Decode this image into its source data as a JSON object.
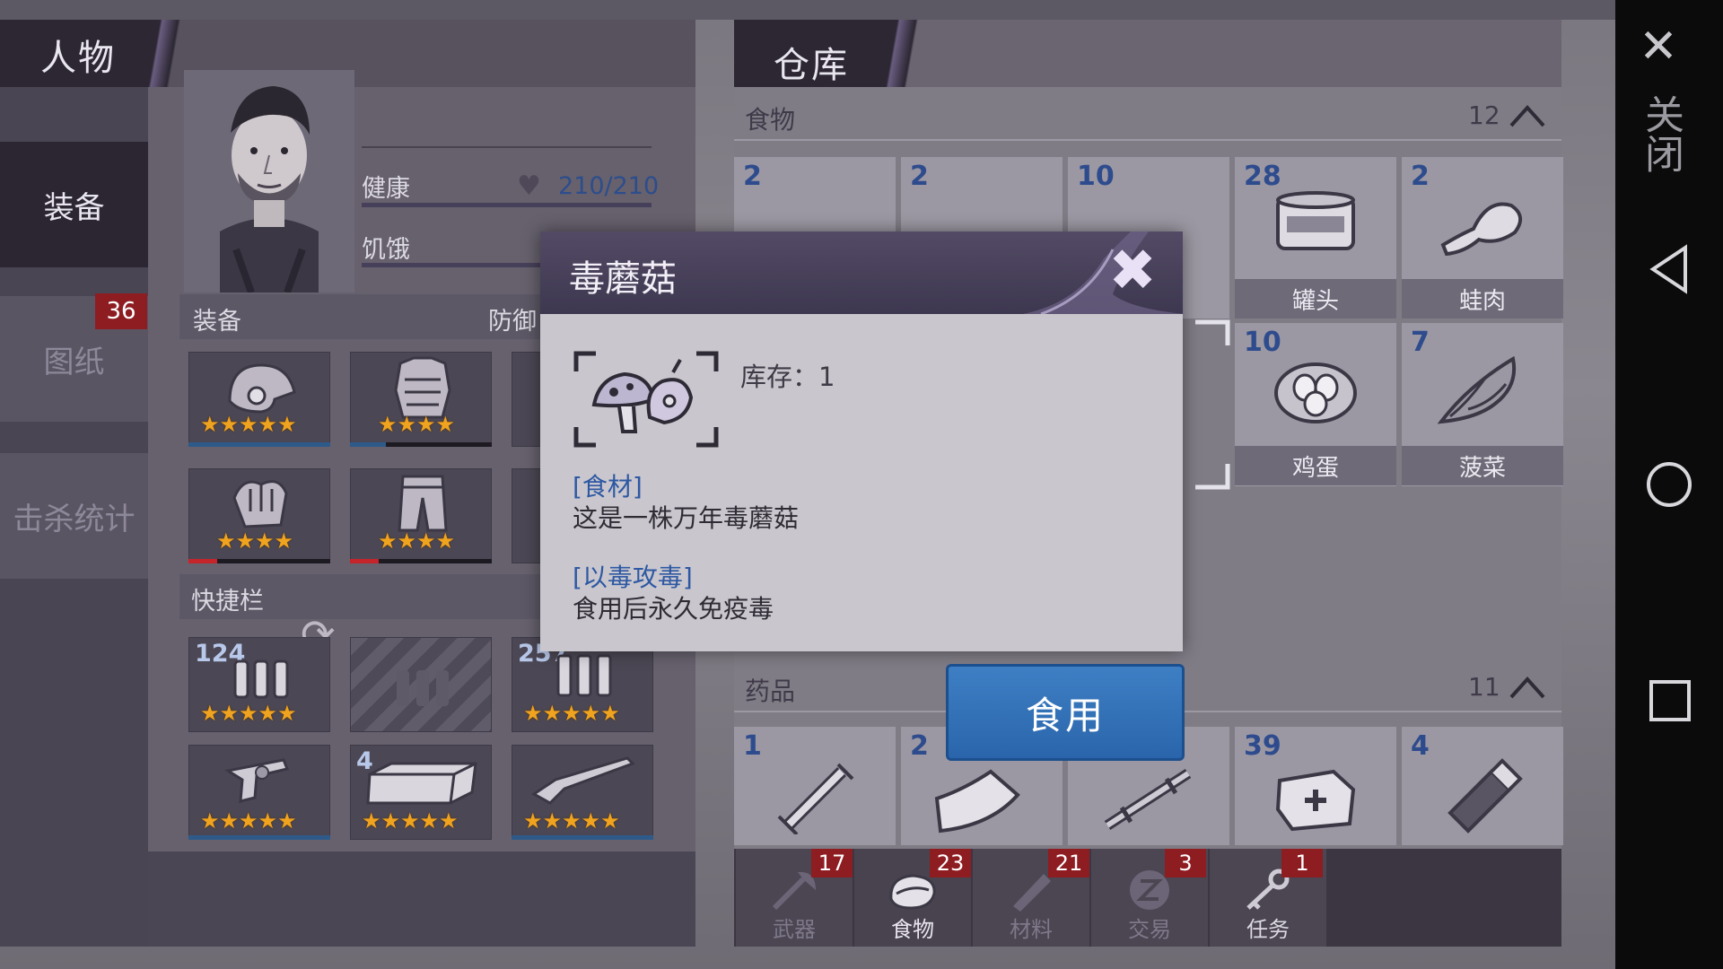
{
  "character": {
    "title": "人物",
    "nav": {
      "equipment": "装备",
      "blueprints": "图纸",
      "blueprints_badge": "36",
      "kills": "击杀统计"
    },
    "stats": {
      "health_label": "健康",
      "health_value": "210/210",
      "hunger_label": "饥饿"
    },
    "sections": {
      "equipment": "装备",
      "defense": "防御",
      "quickbar": "快捷栏"
    },
    "equipment_slots": [
      {
        "name": "helmet",
        "stars": "★★★★★",
        "durability": 1.0
      },
      {
        "name": "armor",
        "stars": "★★★★",
        "durability": 0.25
      },
      {
        "name": "gloves",
        "stars": "★★★★",
        "durability": 0.2
      },
      {
        "name": "pants",
        "stars": "★★★★",
        "durability": 0.2
      }
    ],
    "quickbar": [
      {
        "name": "ammo",
        "count": "124",
        "stars": "★★★★★"
      },
      {
        "name": "empty",
        "count": "",
        "stars": ""
      },
      {
        "name": "shotgun-shells",
        "count": "257",
        "stars": "★★★★★"
      },
      {
        "name": "revolver",
        "count": "",
        "stars": "★★★★★"
      },
      {
        "name": "brick",
        "count": "4",
        "stars": "★★★★★"
      },
      {
        "name": "shotgun",
        "count": "",
        "stars": "★★★★★"
      }
    ]
  },
  "warehouse": {
    "title": "仓库",
    "food": {
      "label": "食物",
      "count": "12",
      "items": [
        {
          "count": "2",
          "name": ""
        },
        {
          "count": "2",
          "name": ""
        },
        {
          "count": "10",
          "name": ""
        },
        {
          "count": "28",
          "name": "罐头"
        },
        {
          "count": "2",
          "name": "蛙肉"
        }
      ],
      "items_row2": [
        {
          "count": "10",
          "name": "鸡蛋"
        },
        {
          "count": "7",
          "name": "菠菜"
        }
      ]
    },
    "medicine": {
      "label": "药品",
      "count": "11",
      "items": [
        {
          "count": "1"
        },
        {
          "count": "2"
        },
        {
          "count": ""
        },
        {
          "count": "39"
        },
        {
          "count": "4"
        }
      ]
    },
    "tabs": [
      {
        "label": "武器",
        "badge": "17"
      },
      {
        "label": "食物",
        "badge": "23"
      },
      {
        "label": "材料",
        "badge": "21"
      },
      {
        "label": "交易",
        "badge": "3"
      },
      {
        "label": "任务",
        "badge": "1"
      }
    ]
  },
  "dialog": {
    "title": "毒蘑菇",
    "stock": "库存：1",
    "tag1": "[食材]",
    "desc1": "这是一株万年毒蘑菇",
    "tag2": "[以毒攻毒]",
    "desc2": "食用后永久免疫毒",
    "use_button": "食用"
  },
  "system": {
    "close_label": "关闭"
  },
  "colors": {
    "accent_blue": "#2a65ab",
    "badge_red": "#8e1d22",
    "star_gold": "#f0a31f"
  }
}
